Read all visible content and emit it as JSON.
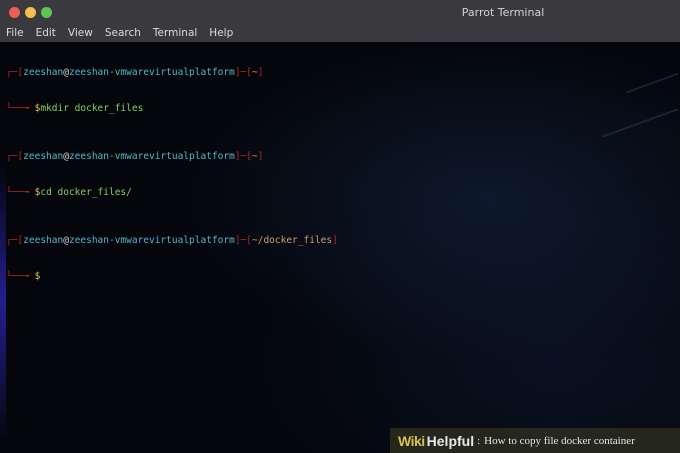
{
  "window": {
    "title": "Parrot Terminal"
  },
  "menu": [
    "File",
    "Edit",
    "View",
    "Search",
    "Terminal",
    "Help"
  ],
  "terminal": {
    "lines": [
      {
        "type": "prompt",
        "open": "┌─[",
        "user": "zeeshan",
        "at": "@",
        "host": "zeeshan-vmwarevirtualplatform",
        "mid": "]─[",
        "path": "~",
        "close": "]"
      },
      {
        "type": "command",
        "arrow": "└──╼ ",
        "dollar": "$",
        "cmd": "mkdir docker_files"
      },
      {
        "type": "prompt",
        "open": "┌─[",
        "user": "zeeshan",
        "at": "@",
        "host": "zeeshan-vmwarevirtualplatform",
        "mid": "]─[",
        "path": "~",
        "close": "]"
      },
      {
        "type": "command",
        "arrow": "└──╼ ",
        "dollar": "$",
        "cmd": "cd docker_files/"
      },
      {
        "type": "prompt",
        "open": "┌─[",
        "user": "zeeshan",
        "at": "@",
        "host": "zeeshan-vmwarevirtualplatform",
        "mid": "]─[",
        "path": "~/docker_files",
        "close": "]"
      },
      {
        "type": "command",
        "arrow": "└──╼ ",
        "dollar": "$",
        "cmd": ""
      }
    ]
  },
  "watermark": {
    "brand_wiki": "Wiki",
    "brand_helpful": "Helpful",
    "separator": ":",
    "caption": "How to copy file docker  container"
  },
  "colors": {
    "titlebar": "#3a3a3e",
    "terminal_bg": "#04060c",
    "bracket": "#c0202c",
    "user_host": "#4fb8c8",
    "command": "#7fd35c",
    "dollar": "#e8c04a"
  }
}
